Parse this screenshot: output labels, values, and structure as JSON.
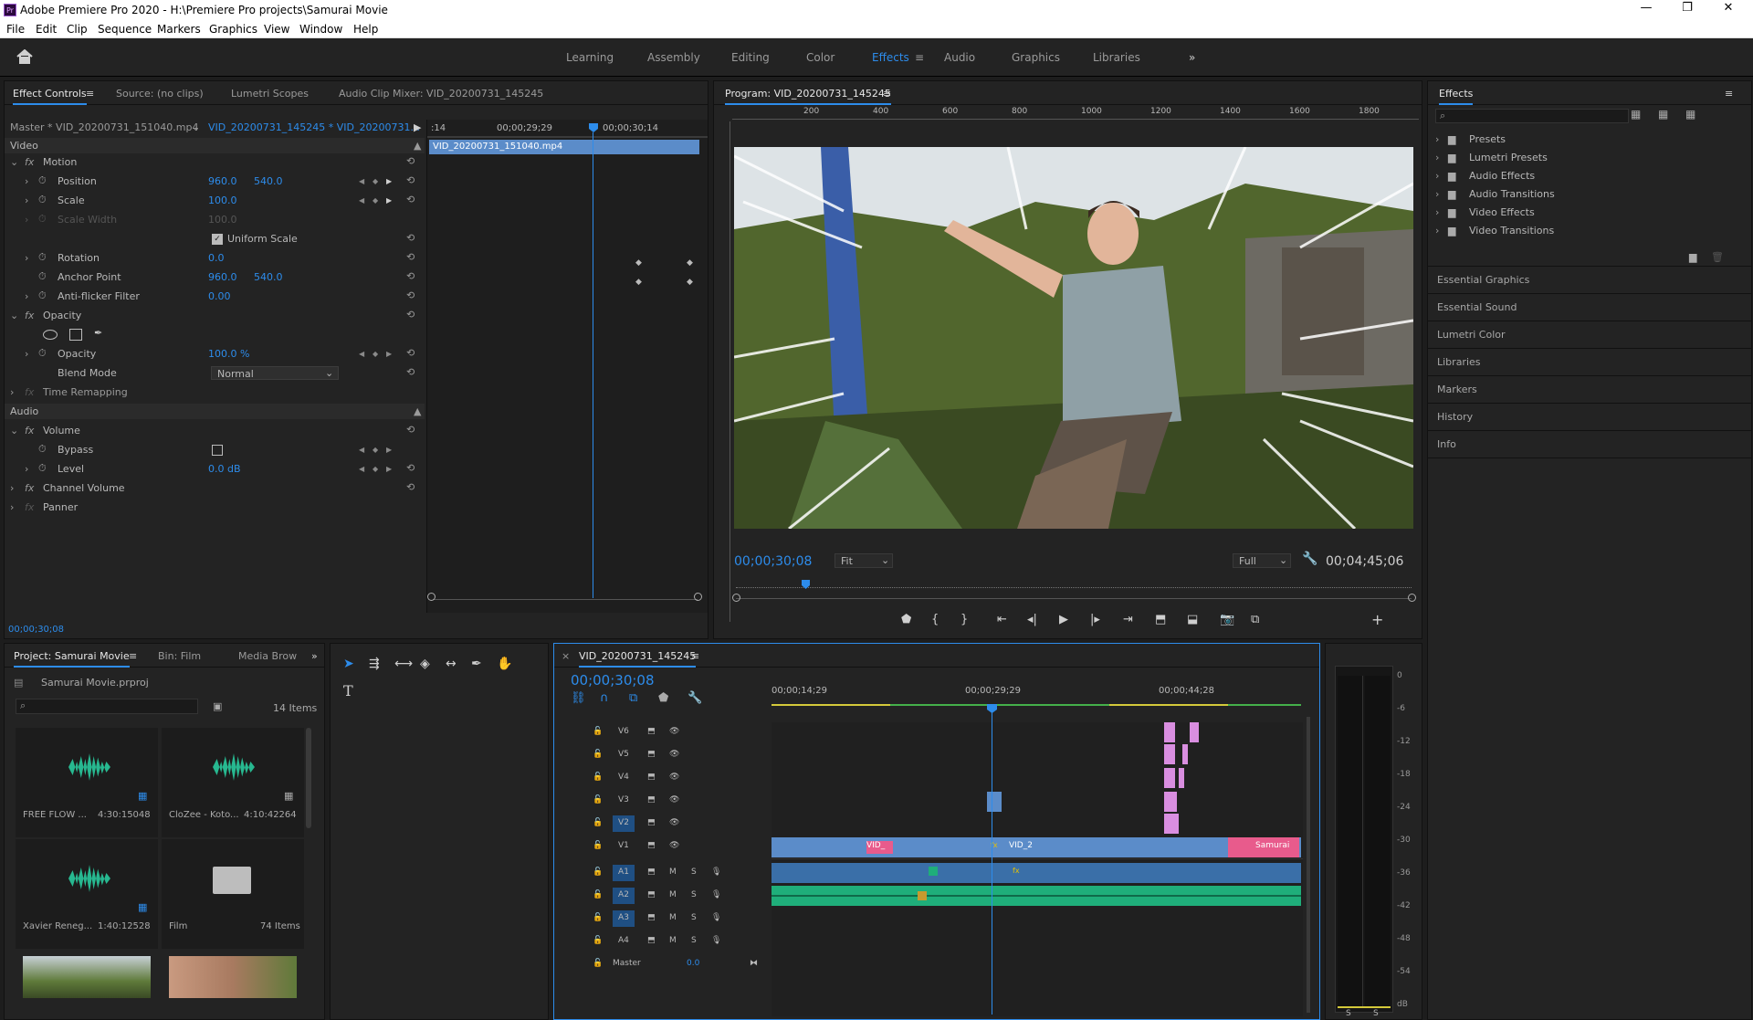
{
  "title": "Adobe Premiere Pro 2020 - H:\\Premiere Pro projects\\Samurai Movie",
  "app_icon": "Pr",
  "window_controls": [
    "—",
    "❐",
    "✕"
  ],
  "menu": [
    "File",
    "Edit",
    "Clip",
    "Sequence",
    "Markers",
    "Graphics",
    "View",
    "Window",
    "Help"
  ],
  "workspaces": [
    "Learning",
    "Assembly",
    "Editing",
    "Color",
    "Effects",
    "Audio",
    "Graphics",
    "Libraries"
  ],
  "active_workspace": "Effects",
  "effect_controls": {
    "tabs": [
      "Effect Controls",
      "Source: (no clips)",
      "Lumetri Scopes",
      "Audio Clip Mixer: VID_20200731_145245"
    ],
    "master": "Master * VID_20200731_151040.mp4",
    "sequence": "VID_20200731_145245 * VID_20200731...",
    "ruler": [
      ":14",
      "00;00;29;29",
      "00;00;30;14"
    ],
    "clip_bar": "VID_20200731_151040.mp4",
    "video": "Video",
    "audio": "Audio",
    "motion": "Motion",
    "position": {
      "label": "Position",
      "x": "960.0",
      "y": "540.0"
    },
    "scale": {
      "label": "Scale",
      "v": "100.0"
    },
    "scale_width": {
      "label": "Scale Width",
      "v": "100.0"
    },
    "uniform": "Uniform Scale",
    "rotation": {
      "label": "Rotation",
      "v": "0.0"
    },
    "anchor": {
      "label": "Anchor Point",
      "x": "960.0",
      "y": "540.0"
    },
    "antiflicker": {
      "label": "Anti-flicker Filter",
      "v": "0.00"
    },
    "opacity_fx": "Opacity",
    "opacity": {
      "label": "Opacity",
      "v": "100.0 %"
    },
    "blend": {
      "label": "Blend Mode",
      "v": "Normal"
    },
    "time_remap": "Time Remapping",
    "volume": "Volume",
    "bypass": "Bypass",
    "level": {
      "label": "Level",
      "v": "0.0 dB"
    },
    "channel_volume": "Channel Volume",
    "panner": "Panner",
    "timecode": "00;00;30;08"
  },
  "program": {
    "tab": "Program: VID_20200731_145245",
    "ruler": [
      "200",
      "400",
      "600",
      "800",
      "1000",
      "1200",
      "1400",
      "1600",
      "1800"
    ],
    "timecode": "00;00;30;08",
    "fit": "Fit",
    "quality": "Full",
    "duration": "00;04;45;06"
  },
  "effects": {
    "title": "Effects",
    "items": [
      "Presets",
      "Lumetri Presets",
      "Audio Effects",
      "Audio Transitions",
      "Video Effects",
      "Video Transitions"
    ],
    "panels": [
      "Essential Graphics",
      "Essential Sound",
      "Lumetri Color",
      "Libraries",
      "Markers",
      "History",
      "Info"
    ]
  },
  "project": {
    "tabs": [
      "Project: Samurai Movie",
      "Bin: Film",
      "Media Brow"
    ],
    "file": "Samurai Movie.prproj",
    "count": "14 Items",
    "items": [
      {
        "name": "FREE FLOW ...",
        "dur": "4:30:15048"
      },
      {
        "name": "CloZee - Koto...",
        "dur": "4:10:42264"
      },
      {
        "name": "Xavier Reneg...",
        "dur": "1:40:12528"
      },
      {
        "name": "Film",
        "dur": "74 Items"
      }
    ]
  },
  "timeline": {
    "tab": "VID_20200731_145245",
    "timecode": "00;00;30;08",
    "ruler": [
      "00;00;14;29",
      "00;00;29;29",
      "00;00;44;28"
    ],
    "video_tracks": [
      "V6",
      "V5",
      "V4",
      "V3",
      "V2",
      "V1"
    ],
    "audio_tracks": [
      "A1",
      "A2",
      "A3",
      "A4"
    ],
    "master": "Master",
    "master_val": "0.0",
    "m": "M",
    "s": "S",
    "clip_labels": [
      "VID_",
      "VID_2",
      "Samurai"
    ]
  },
  "meter": [
    "0",
    "-6",
    "-12",
    "-18",
    "-24",
    "-30",
    "-36",
    "-42",
    "-48",
    "-54",
    "dB"
  ],
  "meter_lr": [
    "S",
    "S"
  ],
  "colors": {
    "accent": "#2d8ceb",
    "clip_video": "#5b8cc9",
    "clip_pink": "#e85b8c",
    "clip_audio": "#1fae7a",
    "magenta": "#d98ee0"
  }
}
